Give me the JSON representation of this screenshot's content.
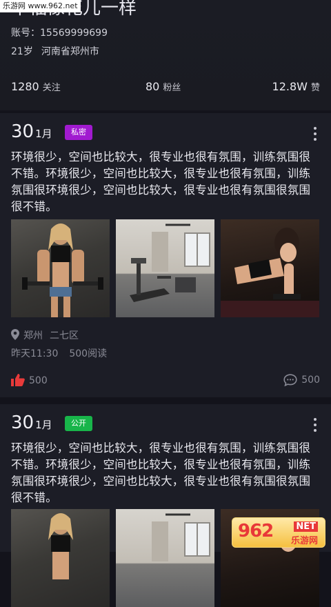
{
  "watermark": {
    "top_left": "乐游网 www.962.net",
    "bottom_right_num": "962",
    "bottom_right_net": "NET",
    "bottom_right_cn": "乐游网"
  },
  "profile": {
    "name": "幸福像花儿一样",
    "account": "账号：15569999699",
    "age": "21岁",
    "location": "河南省郑州市"
  },
  "stats": {
    "follow_count": "1280",
    "follow_label": "关注",
    "fans_count": "80",
    "fans_label": "粉丝",
    "likes_count": "12.8W",
    "likes_label": "赞"
  },
  "posts": [
    {
      "day": "30",
      "month": "1月",
      "badge": "私密",
      "text": "环境很少，空间也比较大，很专业也很有氛围，训练氛围很不错。环境很少，空间也比较大，很专业也很有氛围，训练氛围很环境很少，空间也比较大，很专业也很有氛围很氛围很不错。",
      "photos": [
        "fitness-woman-dumbbells",
        "home-gym-treadmill",
        "woman-plank-exercise"
      ],
      "location_city": "郑州",
      "location_district": "二七区",
      "time": "昨天11:30",
      "reads": "500阅读",
      "likes": "500",
      "comments": "500"
    },
    {
      "day": "30",
      "month": "1月",
      "badge": "公开",
      "text": "环境很少，空间也比较大，很专业也很有氛围，训练氛围很不错。环境很少，空间也比较大，很专业也很有氛围，训练氛围很环境很少，空间也比较大，很专业也很有氛围很氛围很不错。",
      "photos": [
        "fitness-woman-dumbbells",
        "home-gym-treadmill",
        "woman-plank-exercise"
      ]
    }
  ],
  "colors": {
    "private_badge": "#a11ad0",
    "public_badge": "#18b54a",
    "like_icon": "#e83a3a",
    "background": "#13131b"
  }
}
